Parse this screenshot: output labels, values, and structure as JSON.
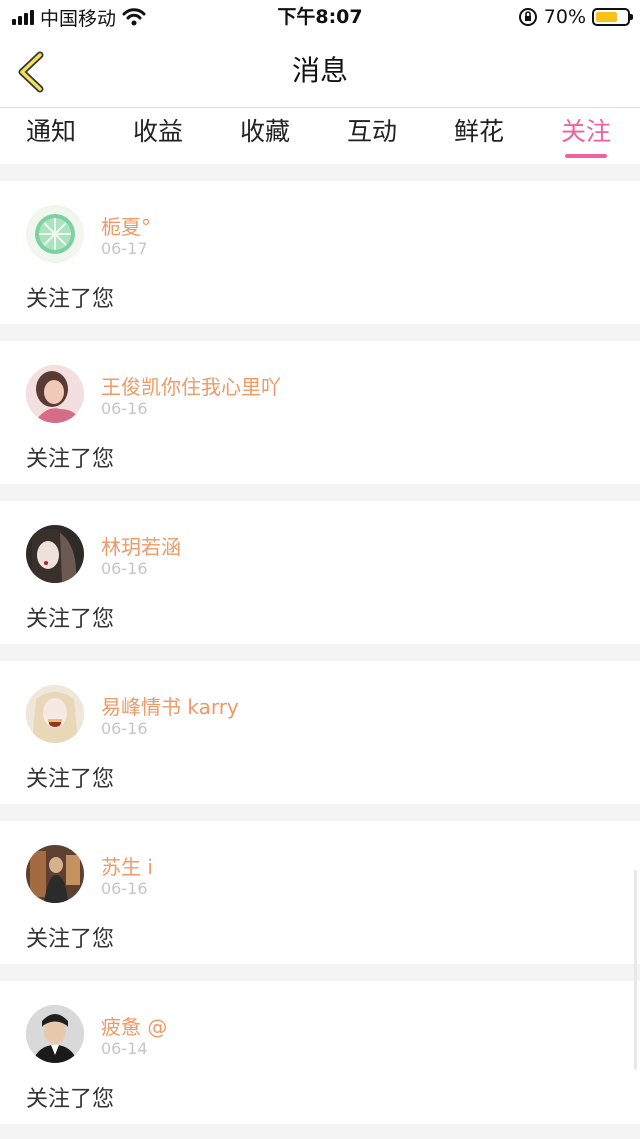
{
  "status_bar": {
    "carrier": "中国移动",
    "time": "下午8:07",
    "battery": "70%",
    "battery_level": 0.7,
    "icons": [
      "signal-icon",
      "wifi-icon",
      "orientation-lock-icon",
      "battery-icon"
    ]
  },
  "nav": {
    "title": "消息",
    "back_icon": "chevron-left-icon"
  },
  "tabs": [
    {
      "label": "通知",
      "active": false
    },
    {
      "label": "收益",
      "active": false
    },
    {
      "label": "收藏",
      "active": false
    },
    {
      "label": "互动",
      "active": false
    },
    {
      "label": "鲜花",
      "active": false
    },
    {
      "label": "关注",
      "active": true
    }
  ],
  "colors": {
    "accent": "#ee62a2",
    "username": "#ef9a66",
    "date": "#c6c6c6",
    "battery": "#f6c21b"
  },
  "messages": [
    {
      "name": "栀夏°",
      "date": "06-17",
      "action": "关注了您",
      "avatar": "lime-avatar-icon"
    },
    {
      "name": "王俊凯你住我心里吖",
      "date": "06-16",
      "action": "关注了您",
      "avatar": "user-avatar"
    },
    {
      "name": "林玥若涵",
      "date": "06-16",
      "action": "关注了您",
      "avatar": "user-avatar"
    },
    {
      "name": "易峰情书 karry",
      "date": "06-16",
      "action": "关注了您",
      "avatar": "user-avatar"
    },
    {
      "name": "苏生 i",
      "date": "06-16",
      "action": "关注了您",
      "avatar": "user-avatar"
    },
    {
      "name": "疲惫 @",
      "date": "06-14",
      "action": "关注了您",
      "avatar": "user-avatar"
    }
  ]
}
